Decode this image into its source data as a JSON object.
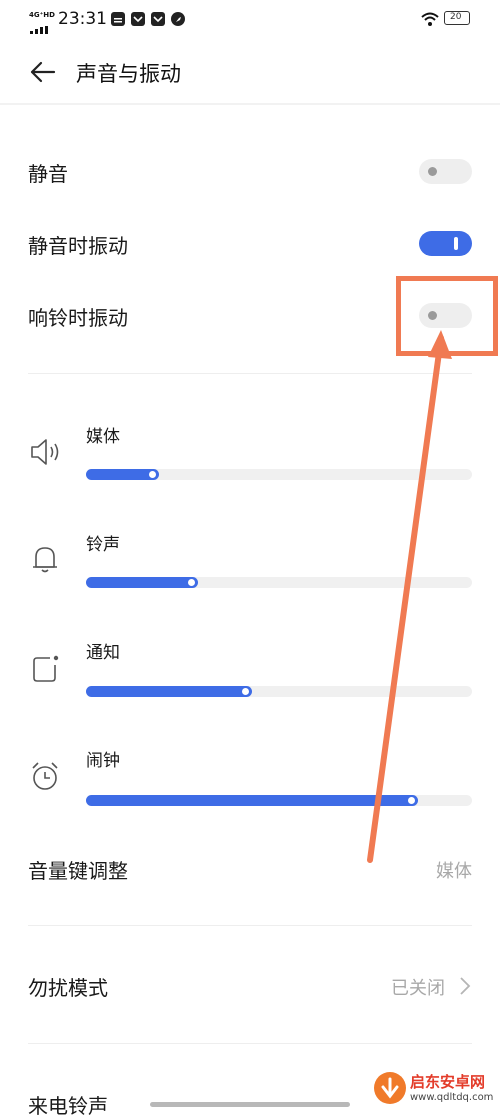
{
  "status_bar": {
    "network_top": "4G⁺HD",
    "time": "23:31",
    "battery": "20",
    "icons": [
      "sim-card-icon",
      "mail-icon",
      "mail-icon",
      "compass-icon"
    ]
  },
  "header": {
    "title": "声音与振动"
  },
  "toggles": [
    {
      "label": "静音",
      "on": false
    },
    {
      "label": "静音时振动",
      "on": true
    },
    {
      "label": "响铃时振动",
      "on": false
    }
  ],
  "volumes": [
    {
      "label": "媒体",
      "icon": "speaker-icon",
      "level": 0.19
    },
    {
      "label": "铃声",
      "icon": "bell-icon",
      "level": 0.29
    },
    {
      "label": "通知",
      "icon": "notification-icon",
      "level": 0.43
    },
    {
      "label": "闹钟",
      "icon": "alarm-clock-icon",
      "level": 0.86
    }
  ],
  "volume_key": {
    "label": "音量键调整",
    "value": "媒体"
  },
  "dnd": {
    "label": "勿扰模式",
    "value": "已关闭"
  },
  "ringtone": {
    "label": "来电铃声"
  },
  "watermark": {
    "text": "启东安卓网",
    "url": "www.qdltdq.com"
  },
  "colors": {
    "accent": "#3e6ce6",
    "annotation": "#f07a52"
  }
}
